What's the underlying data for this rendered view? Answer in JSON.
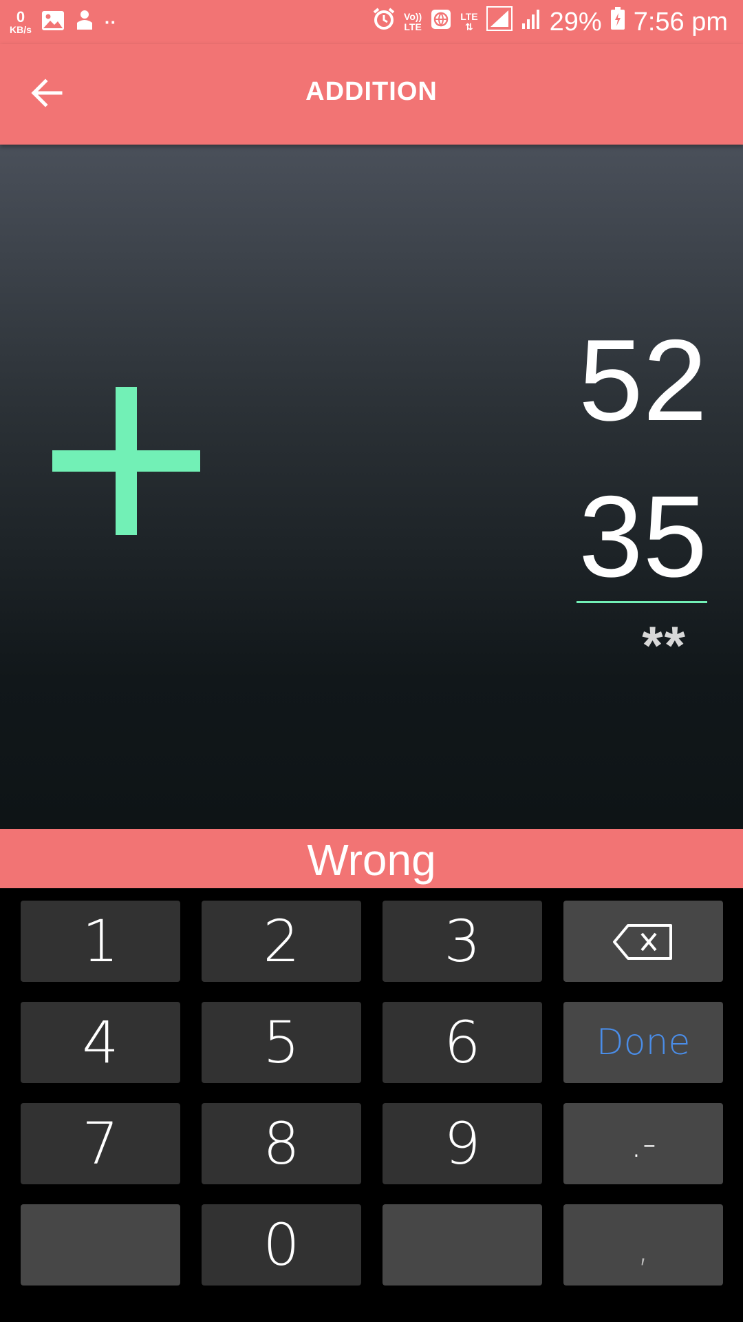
{
  "status_bar": {
    "net_speed_value": "0",
    "net_speed_unit": "KB/s",
    "overflow_dots": "··",
    "volte_top": "Vo))",
    "volte_bottom": "LTE",
    "lte_label": "LTE",
    "battery_percent": "29%",
    "time": "7:56 pm"
  },
  "app_bar": {
    "title": "ADDITION"
  },
  "problem": {
    "operator": "+",
    "operand_1": "52",
    "operand_2": "35",
    "answer_display": "**"
  },
  "feedback": {
    "text": "Wrong"
  },
  "keypad": {
    "keys": {
      "k1": "1",
      "k2": "2",
      "k3": "3",
      "k4": "4",
      "k5": "5",
      "k6": "6",
      "k7": "7",
      "k8": "8",
      "k9": "9",
      "k0": "0",
      "done": "Done",
      "dot_minus": ".-",
      "comma": ","
    },
    "icons": {
      "backspace": "backspace-icon"
    }
  },
  "colors": {
    "accent_red": "#f27474",
    "accent_green": "#72f0b6",
    "done_blue": "#4a8de8"
  }
}
